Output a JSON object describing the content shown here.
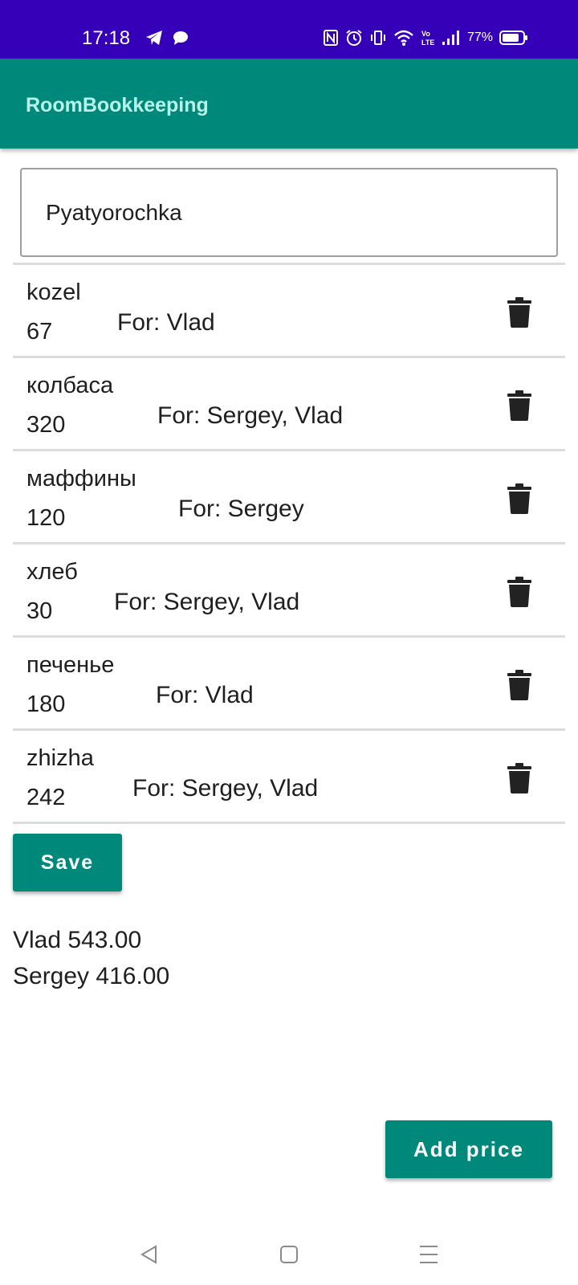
{
  "status_bar": {
    "time": "17:18",
    "battery": "77%",
    "left_icons": [
      "telegram-icon",
      "chat-bubble-icon"
    ],
    "right_icons": [
      "nfc-icon",
      "alarm-icon",
      "vibrate-icon",
      "wifi-icon",
      "volte-icon",
      "signal-icon",
      "battery-icon"
    ],
    "background": "#3600b8"
  },
  "app_bar": {
    "title": "RoomBookkeeping",
    "background": "#00897b",
    "title_color": "#b7f3ea"
  },
  "store_field": {
    "value": "Pyatyorochka"
  },
  "items": [
    {
      "name": "kozel",
      "price": "67",
      "for": "For: Vlad"
    },
    {
      "name": "колбаса",
      "price": "320",
      "for": "For: Sergey, Vlad"
    },
    {
      "name": "маффины",
      "price": "120",
      "for": "For: Sergey"
    },
    {
      "name": "хлеб",
      "price": "30",
      "for": "For: Sergey, Vlad"
    },
    {
      "name": "печенье",
      "price": "180",
      "for": "For: Vlad"
    },
    {
      "name": "zhizha",
      "price": "242",
      "for": "For: Sergey, Vlad"
    }
  ],
  "item_icon": "trash-icon",
  "save_label": "Save",
  "totals": [
    "Vlad 543.00",
    "Sergey 416.00"
  ],
  "add_price_label": "Add price",
  "nav_bar": {
    "icons": [
      "back-icon",
      "home-icon",
      "menu-icon"
    ]
  },
  "accent_color": "#00897b"
}
